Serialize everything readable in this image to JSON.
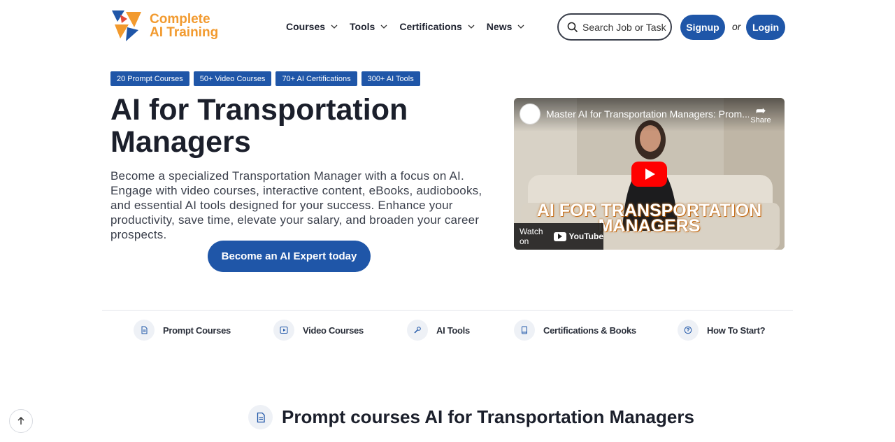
{
  "brand": {
    "line1": "Complete",
    "line2": "AI Training",
    "color": "#f29a2e"
  },
  "nav": [
    {
      "label": "Courses"
    },
    {
      "label": "Tools"
    },
    {
      "label": "Certifications"
    },
    {
      "label": "News"
    }
  ],
  "search": {
    "placeholder": "Search Job or Tasks",
    "icon": "search-icon"
  },
  "auth": {
    "signup": "Signup",
    "or": "or",
    "login": "Login"
  },
  "tags": [
    "20 Prompt Courses",
    "50+ Video Courses",
    "70+ AI Certifications",
    "300+ AI Tools"
  ],
  "hero": {
    "title": "AI for Transportation Managers",
    "description": "Become a specialized Transportation Manager with a focus on AI. Engage with video courses, interactive content, eBooks, audiobooks, and essential AI tools designed for your success. Enhance your productivity, save time, elevate your salary, and broaden your career prospects.",
    "cta": "Become an AI Expert today"
  },
  "video": {
    "title": "Master AI for Transportation Managers: Prom...",
    "share": "Share",
    "banner_line1": "AI FOR TRANSPORTATION",
    "banner_line2": "MANAGERS",
    "watch_on": "Watch on",
    "youtube": "YouTube"
  },
  "quick_links": [
    {
      "label": "Prompt Courses",
      "icon": "document-icon"
    },
    {
      "label": "Video Courses",
      "icon": "play-icon"
    },
    {
      "label": "AI Tools",
      "icon": "wrench-icon"
    },
    {
      "label": "Certifications & Books",
      "icon": "book-icon"
    },
    {
      "label": "How To Start?",
      "icon": "help-icon"
    }
  ],
  "section": {
    "title": "Prompt courses AI for Transportation Managers",
    "icon": "document-icon"
  },
  "colors": {
    "primary": "#1f56a8",
    "accent": "#f29a2e",
    "text": "#1b1f2b"
  }
}
